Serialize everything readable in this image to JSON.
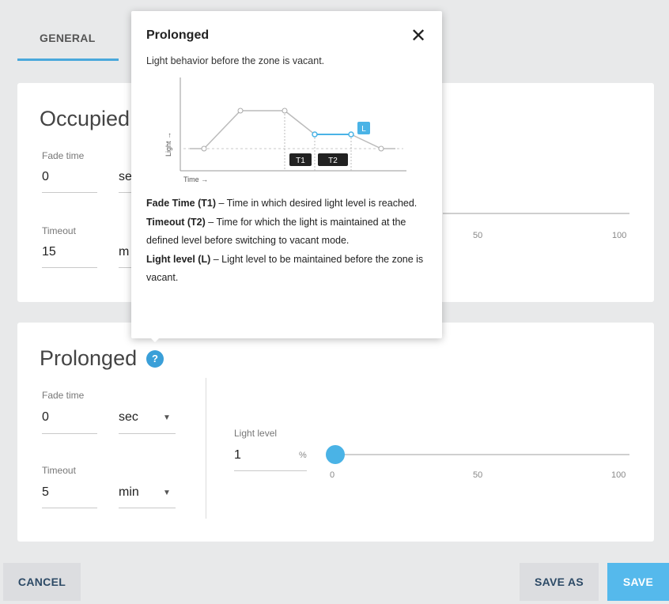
{
  "tabs": {
    "general": "GENERAL"
  },
  "occupied": {
    "title": "Occupied",
    "fade_label": "Fade time",
    "fade_value": "0",
    "fade_unit": "se",
    "timeout_label": "Timeout",
    "timeout_value": "15",
    "timeout_unit": "m",
    "ticks": [
      "50",
      "100"
    ]
  },
  "prolonged": {
    "title": "Prolonged",
    "help_icon": "?",
    "fade_label": "Fade time",
    "fade_value": "0",
    "fade_unit": "sec",
    "timeout_label": "Timeout",
    "timeout_value": "5",
    "timeout_unit": "min",
    "light_label": "Light level",
    "light_value": "1",
    "light_unit": "%",
    "slider_level": 1,
    "ticks": [
      "0",
      "50",
      "100"
    ]
  },
  "tooltip": {
    "title": "Prolonged",
    "subtitle": "Light behavior before the zone is vacant.",
    "diagram": {
      "y_axis": "Light →",
      "x_axis": "Time →",
      "t1": "T1",
      "t2": "T2",
      "l": "L"
    },
    "fade_term": "Fade Time (T1)",
    "fade_desc": " – Time in which desired light level is reached.",
    "timeout_term": "Timeout (T2)",
    "timeout_desc": " – Time for which the light is maintained at the defined level before switching to vacant mode.",
    "light_term": "Light level (L)",
    "light_desc": " – Light level to be maintained before the zone is vacant."
  },
  "buttons": {
    "cancel": "CANCEL",
    "save_as": "SAVE AS",
    "save": "SAVE"
  },
  "colors": {
    "accent": "#4ab3e6",
    "save": "#55b9ec",
    "text_dark": "#2d4a66"
  }
}
